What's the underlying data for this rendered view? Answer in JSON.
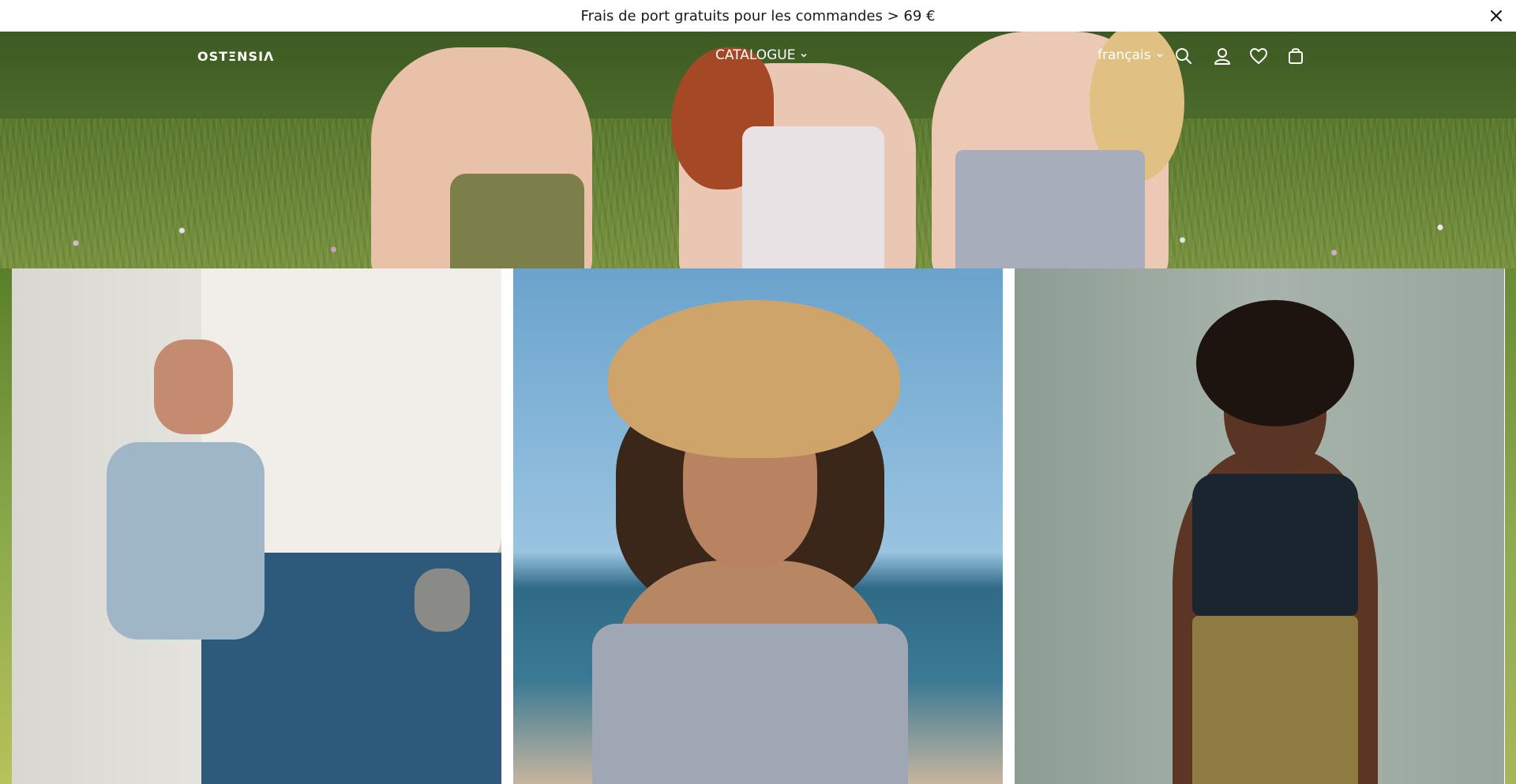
{
  "announcement": {
    "text": "Frais de port gratuits pour les commandes > 69 €"
  },
  "header": {
    "logo": "OSTΞNSIΛ",
    "menu": [
      {
        "label": "CATALOGUE"
      }
    ],
    "language": "français",
    "icons": [
      "search-icon",
      "account-icon",
      "wishlist-icon",
      "cart-icon"
    ]
  },
  "colors": {
    "announcement_bg": "#ffffff",
    "nav_text": "#ffffff"
  }
}
